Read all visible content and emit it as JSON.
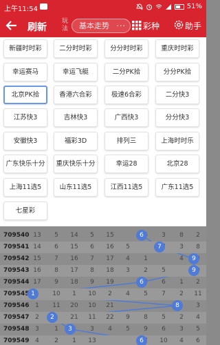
{
  "status": {
    "time": "上午11:54",
    "battery": "51%"
  },
  "header": {
    "back_icon": "arrow-left-icon",
    "refresh": "刷新",
    "wanfa": "玩法",
    "select_value": "基本走势",
    "select_dots": "···",
    "caizhong": "彩种",
    "helper": "助手"
  },
  "lotteries": [
    "新疆时时彩",
    "二分时时彩",
    "分分时时彩",
    "重庆时时彩",
    "幸运赛马",
    "幸运飞艇",
    "二分PK拾",
    "分分PK拾",
    "北京PK拾",
    "香港六合彩",
    "极速6合彩",
    "二分快3",
    "江苏快3",
    "吉林快3",
    "广西快3",
    "分分快3",
    "安徽快3",
    "福彩3D",
    "排列三",
    "上海时时乐",
    "广东快乐十分",
    "重庆快乐十分",
    "幸运28",
    "北京28",
    "上海11选5",
    "山东11选5",
    "江西11选5",
    "广东11选5",
    "七星彩"
  ],
  "selected_lottery": "北京PK拾",
  "table": {
    "rows": [
      {
        "id": "709540",
        "cells": [
          "13",
          "5",
          "14",
          "5",
          "15",
          "",
          "6",
          "3",
          "8",
          "2"
        ],
        "ball": "6"
      },
      {
        "id": "709541",
        "cells": [
          "14",
          "6",
          "15",
          "6",
          "16",
          "5",
          "",
          "7",
          "3",
          "8"
        ],
        "ball": "7"
      },
      {
        "id": "709542",
        "cells": [
          "15",
          "7",
          "16",
          "7",
          "17",
          "4",
          "1",
          "",
          "4",
          "9"
        ],
        "ball": "9"
      },
      {
        "id": "709543",
        "cells": [
          "16",
          "8",
          "17",
          "8",
          "18",
          "3",
          "2",
          "5",
          "",
          "9"
        ],
        "ball": "9"
      },
      {
        "id": "709544",
        "cells": [
          "17",
          "9",
          "18",
          "9",
          "19",
          "",
          "3",
          "6",
          "1",
          "2"
        ],
        "ball": "6"
      },
      {
        "id": "709545",
        "cells": [
          "",
          "10",
          "1",
          "10",
          "2",
          "4",
          "5",
          "7",
          "2",
          "11"
        ],
        "ball": "1"
      },
      {
        "id": "709546",
        "cells": [
          "1",
          "11",
          "20",
          "10",
          "21",
          "",
          "",
          "",
          "",
          "3"
        ],
        "ball": "8"
      },
      {
        "id": "709547",
        "cells": [
          "2",
          "",
          "21",
          "11",
          "22",
          "9",
          "8",
          "5",
          "2",
          "4"
        ],
        "ball": "2"
      },
      {
        "id": "709548",
        "cells": [
          "3",
          "1",
          "",
          "3",
          "4",
          "5",
          "9",
          "6",
          "3",
          "5"
        ],
        "ball": "3"
      },
      {
        "id": "709549",
        "cells": [
          "4",
          "2",
          "1",
          "13",
          "",
          "",
          "7",
          "10",
          "4",
          "6"
        ],
        "ball": "6"
      }
    ]
  }
}
